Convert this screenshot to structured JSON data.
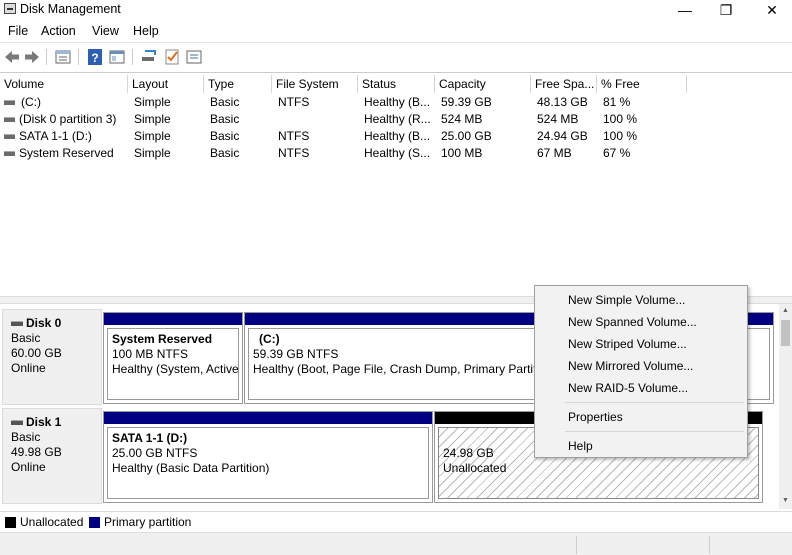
{
  "window": {
    "title": "Disk Management",
    "controls": {
      "minimize": "—",
      "maximize": "❐",
      "close": "✕"
    }
  },
  "menu": [
    "File",
    "Action",
    "View",
    "Help"
  ],
  "toolbar": [
    "back-icon",
    "forward-icon",
    "properties-icon",
    "help-icon",
    "console-icon",
    "rescan-icon",
    "check-icon",
    "list-icon"
  ],
  "volume_table": {
    "columns": [
      "Volume",
      "Layout",
      "Type",
      "File System",
      "Status",
      "Capacity",
      "Free Spa...",
      "% Free"
    ],
    "rows": [
      [
        "(C:)",
        "Simple",
        "Basic",
        "NTFS",
        "Healthy (B...",
        "59.39 GB",
        "48.13 GB",
        "81 %"
      ],
      [
        "(Disk 0 partition 3)",
        "Simple",
        "Basic",
        "",
        "Healthy (R...",
        "524 MB",
        "524 MB",
        "100 %"
      ],
      [
        "SATA 1-1 (D:)",
        "Simple",
        "Basic",
        "NTFS",
        "Healthy (B...",
        "25.00 GB",
        "24.94 GB",
        "100 %"
      ],
      [
        "System Reserved",
        "Simple",
        "Basic",
        "NTFS",
        "Healthy (S...",
        "100 MB",
        "67 MB",
        "67 %"
      ]
    ]
  },
  "disks": [
    {
      "name": "Disk 0",
      "type": "Basic",
      "size": "60.00 GB",
      "state": "Online",
      "partitions": [
        {
          "name": "System Reserved",
          "size": "100 MB NTFS",
          "status": "Healthy (System, Active"
        },
        {
          "name": "(C:)",
          "size": "59.39 GB NTFS",
          "status": "Healthy (Boot, Page File, Crash Dump, Primary Partiti"
        }
      ]
    },
    {
      "name": "Disk 1",
      "type": "Basic",
      "size": "49.98 GB",
      "state": "Online",
      "partitions": [
        {
          "name": "SATA 1-1  (D:)",
          "size": "25.00 GB NTFS",
          "status": "Healthy (Basic Data Partition)"
        },
        {
          "name": "",
          "size": "24.98 GB",
          "status": "Unallocated"
        }
      ]
    }
  ],
  "legend": [
    {
      "label": "Unallocated",
      "color": "#000000"
    },
    {
      "label": "Primary partition",
      "color": "#000080"
    }
  ],
  "context_menu": {
    "items": [
      "New Simple Volume...",
      "New Spanned Volume...",
      "New Striped Volume...",
      "New Mirrored Volume...",
      "New RAID-5 Volume...",
      "Properties",
      "Help"
    ]
  }
}
